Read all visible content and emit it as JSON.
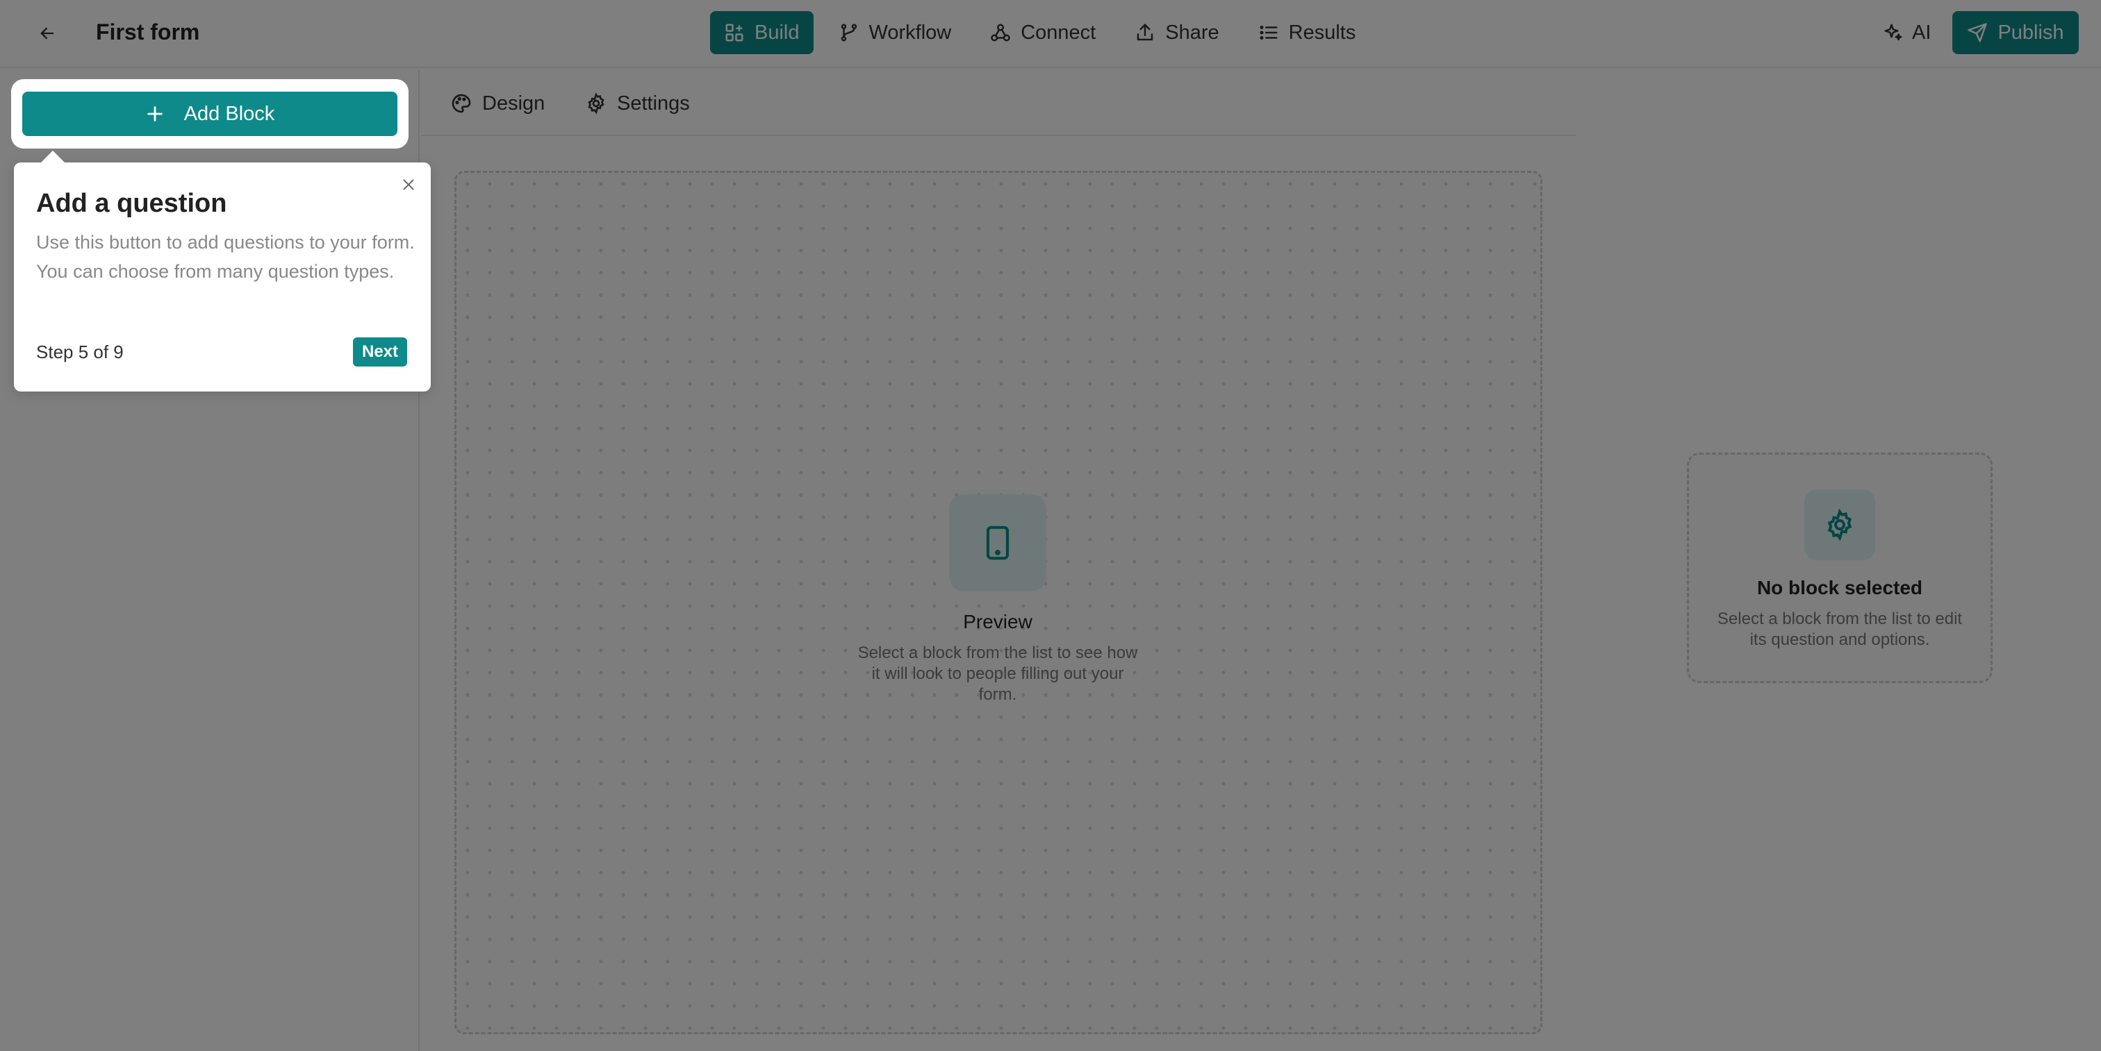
{
  "header": {
    "title": "First form",
    "nav": [
      {
        "label": "Build",
        "icon": "blocks-icon",
        "active": true
      },
      {
        "label": "Workflow",
        "icon": "branch-icon",
        "active": false
      },
      {
        "label": "Connect",
        "icon": "webhook-icon",
        "active": false
      },
      {
        "label": "Share",
        "icon": "share-icon",
        "active": false
      },
      {
        "label": "Results",
        "icon": "list-icon",
        "active": false
      }
    ],
    "ai_label": "AI",
    "publish_label": "Publish"
  },
  "sidebar": {
    "add_block_label": "Add Block"
  },
  "center": {
    "tabs": [
      {
        "label": "Design",
        "icon": "palette-icon"
      },
      {
        "label": "Settings",
        "icon": "gear-icon"
      }
    ],
    "preview_title": "Preview",
    "preview_desc": "Select a block from the list to see how it will look to people filling out your form."
  },
  "right_panel": {
    "title": "No block selected",
    "desc": "Select a block from the list to edit its question and options."
  },
  "tour": {
    "title": "Add a question",
    "desc": "Use this button to add questions to your form. You can choose from many question types.",
    "step": "Step 5 of 9",
    "next_label": "Next"
  },
  "colors": {
    "accent": "#0e8a8a",
    "accent_light": "#dff1f1"
  }
}
